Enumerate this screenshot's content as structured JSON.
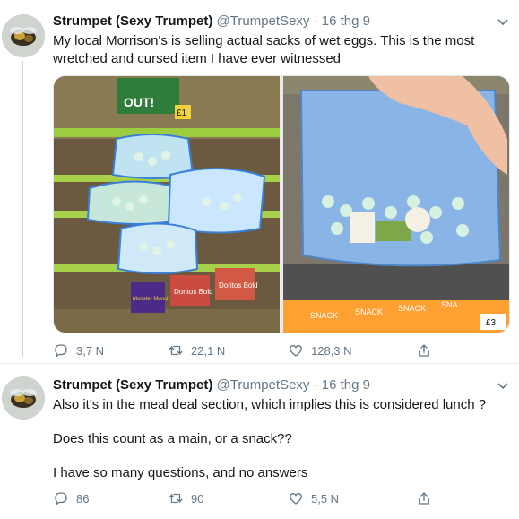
{
  "tweets": [
    {
      "name": "Strumpet (Sexy Trumpet)",
      "handle": "@TrumpetSexy",
      "dot": "·",
      "date": "16 thg 9",
      "text_lines": [
        "My local Morrison's is selling actual sacks of wet eggs. This is the most",
        "wretched and cursed item I have ever witnessed"
      ],
      "media": [
        {
          "description": "supermarket shelf",
          "price_tag": "£1",
          "sign": "OUT!",
          "snacks": [
            "Doritos Bold",
            "Doritos Bold",
            "Monster Munch"
          ]
        },
        {
          "description": "hand holding bag",
          "shelf_labels": [
            "SNACK",
            "SNACK",
            "SNACK",
            "SNA"
          ],
          "price": "£3"
        }
      ],
      "actions": {
        "replies": "3,7 N",
        "retweets": "22,1 N",
        "likes": "128,3 N"
      }
    },
    {
      "name": "Strumpet (Sexy Trumpet)",
      "handle": "@TrumpetSexy",
      "dot": "·",
      "date": "16 thg 9",
      "paragraphs": [
        "Also it's in the meal deal section, which implies this is considered lunch ?",
        "Does this count as a main, or a snack??",
        "I have so many questions, and no answers"
      ],
      "actions": {
        "replies": "86",
        "retweets": "90",
        "likes": "5,5 N"
      }
    }
  ],
  "colors": {
    "secondary_text": "#657786",
    "accent_blue": "#1da1f2",
    "divider": "#e6ecf0"
  },
  "icons": [
    "reply-icon",
    "retweet-icon",
    "like-icon",
    "share-icon",
    "chevron-down-icon"
  ]
}
